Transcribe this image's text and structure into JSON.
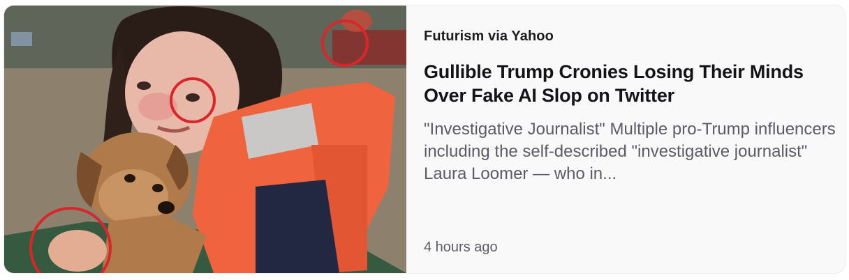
{
  "article": {
    "source": "Futurism via Yahoo",
    "headline": "Gullible Trump Cronies Losing Their Minds Over Fake AI Slop on Twitter",
    "summary": "\"Investigative Journalist\" Multiple pro-Trump influencers including the self-described \"investigative journalist\" Laura Loomer — who in...",
    "timestamp": "4 hours ago"
  },
  "image": {
    "subject": "girl-in-life-vest-holding-puppy",
    "annotation_color": "#d9262a",
    "vest_color": "#f0633f"
  }
}
